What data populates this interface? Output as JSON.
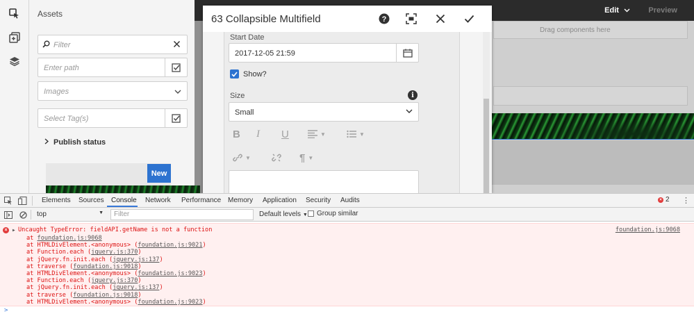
{
  "sidebar": {
    "assets_title": "Assets",
    "filter_placeholder": "Filter",
    "path_placeholder": "Enter path",
    "type_value": "Images",
    "tags_placeholder": "Select Tag(s)",
    "publish_status": "Publish status",
    "new_badge": "New"
  },
  "page_toolbar": {
    "edit_label": "Edit",
    "preview_label": "Preview"
  },
  "canvas": {
    "drop_hint": "Drag components here"
  },
  "dialog": {
    "title": "63 Collapsible Multifield",
    "start_date_label": "Start Date",
    "start_date_value": "2017-12-05 21:59",
    "show_label": "Show?",
    "show_checked": true,
    "size_label": "Size",
    "size_value": "Small"
  },
  "devtools": {
    "tabs": [
      "Elements",
      "Sources",
      "Console",
      "Network",
      "Performance",
      "Memory",
      "Application",
      "Security",
      "Audits"
    ],
    "active_tab": "Console",
    "error_count": "2",
    "context": "top",
    "filter_placeholder": "Filter",
    "levels": "Default levels",
    "group_similar": "Group similar",
    "error": {
      "message": "Uncaught TypeError: fieldAPI.getName is not a function",
      "source": "foundation.js:9068",
      "stack": [
        {
          "text": "at ",
          "link": "foundation.js:9068",
          "suffix": ""
        },
        {
          "text": "at HTMLDivElement.<anonymous> (",
          "link": "foundation.js:9021",
          "suffix": ")"
        },
        {
          "text": "at Function.each (",
          "link": "jquery.js:370",
          "suffix": ")"
        },
        {
          "text": "at jQuery.fn.init.each (",
          "link": "jquery.js:137",
          "suffix": ")"
        },
        {
          "text": "at traverse (",
          "link": "foundation.js:9018",
          "suffix": ")"
        },
        {
          "text": "at HTMLDivElement.<anonymous> (",
          "link": "foundation.js:9023",
          "suffix": ")"
        },
        {
          "text": "at Function.each (",
          "link": "jquery.js:370",
          "suffix": ")"
        },
        {
          "text": "at jQuery.fn.init.each (",
          "link": "jquery.js:137",
          "suffix": ")"
        },
        {
          "text": "at traverse (",
          "link": "foundation.js:9018",
          "suffix": ")"
        },
        {
          "text": "at HTMLDivElement.<anonymous> (",
          "link": "foundation.js:9023",
          "suffix": ")"
        }
      ]
    },
    "prompt": ">"
  },
  "colors": {
    "accent": "#2d73d0",
    "error_text": "#dd1111",
    "error_bg": "#fff0f0",
    "devtools_active": "#3879d9"
  }
}
